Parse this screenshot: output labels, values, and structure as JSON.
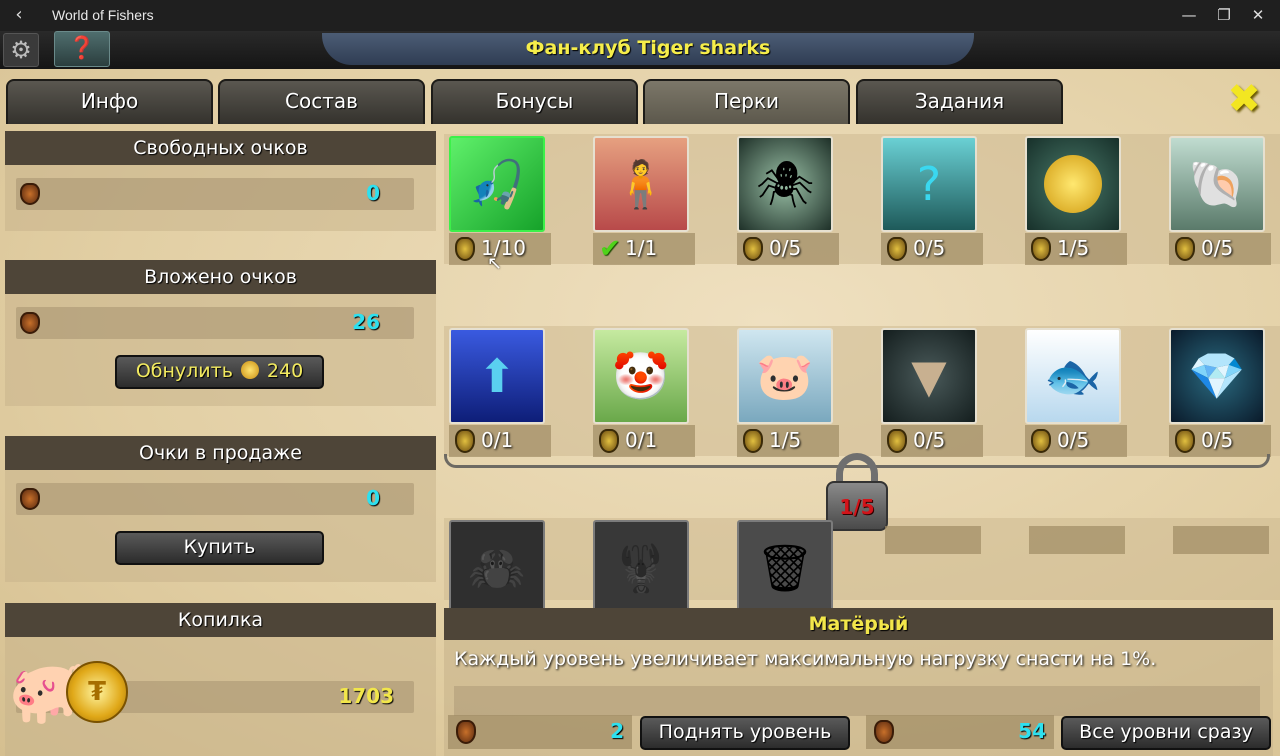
{
  "window": {
    "title": "World of Fishers",
    "back_glyph": "‹",
    "min_glyph": "—",
    "max_glyph": "❐",
    "close_glyph": "✕"
  },
  "topbar": {
    "club_title": "Фан-клуб Tiger sharks",
    "gear_icon": "gear-icon",
    "avatar_icon": "fishing-bait-icon"
  },
  "tabs": [
    {
      "label": "Инфо",
      "active": false
    },
    {
      "label": "Состав",
      "active": false
    },
    {
      "label": "Бонусы",
      "active": false
    },
    {
      "label": "Перки",
      "active": true
    },
    {
      "label": "Задания",
      "active": false
    }
  ],
  "left": {
    "free_points": {
      "title": "Свободных очков",
      "value": "0"
    },
    "invested_points": {
      "title": "Вложено очков",
      "value": "26",
      "reset_label": "Обнулить",
      "reset_cost": "240"
    },
    "points_for_sale": {
      "title": "Очки в продаже",
      "value": "0",
      "buy_label": "Купить"
    },
    "piggy_bank": {
      "title": "Копилка",
      "value": "1703"
    }
  },
  "perks": {
    "row1": [
      {
        "icon": "fishing-rod-icon",
        "count": "1/10",
        "maxed": false,
        "color": "#2ec23a"
      },
      {
        "icon": "fisherman-icon",
        "count": "1/1",
        "maxed": true,
        "color": "#d8645a"
      },
      {
        "icon": "spider-icon",
        "count": "0/5",
        "maxed": false,
        "color": "#3e5a4a"
      },
      {
        "icon": "mystery-fish-icon",
        "count": "0/5",
        "maxed": false,
        "color": "#3a7c78"
      },
      {
        "icon": "gold-coin-icon",
        "count": "1/5",
        "maxed": false,
        "color": "#2f5a4c"
      },
      {
        "icon": "nautilus-icon",
        "count": "0/5",
        "maxed": false,
        "color": "#7ea08e"
      }
    ],
    "row2": [
      {
        "icon": "arrow-up-icon",
        "count": "0/1",
        "color": "#1e3ea8"
      },
      {
        "icon": "jack-in-box-icon",
        "count": "0/1",
        "color": "#8ec86a"
      },
      {
        "icon": "piggy-bank-icon",
        "count": "1/5",
        "color": "#7ab0c8"
      },
      {
        "icon": "shark-tooth-icon",
        "count": "0/5",
        "color": "#2a3a3a"
      },
      {
        "icon": "crystal-fish-icon",
        "count": "0/5",
        "color": "#d8ecf6"
      },
      {
        "icon": "diamond-icon",
        "count": "0/5",
        "color": "#1a3a50"
      }
    ],
    "row3": [
      {
        "icon": "crab-icon"
      },
      {
        "icon": "lobster-icon"
      },
      {
        "icon": "trash-bin-icon"
      }
    ],
    "lock_progress": "1/5"
  },
  "description": {
    "title": "Матёрый",
    "text": "Каждый уровень увеличивает максимальную нагрузку снасти на 1%.",
    "level_cost": "2",
    "level_up_label": "Поднять уровень",
    "all_levels_cost": "54",
    "all_levels_label": "Все уровни сразу"
  }
}
